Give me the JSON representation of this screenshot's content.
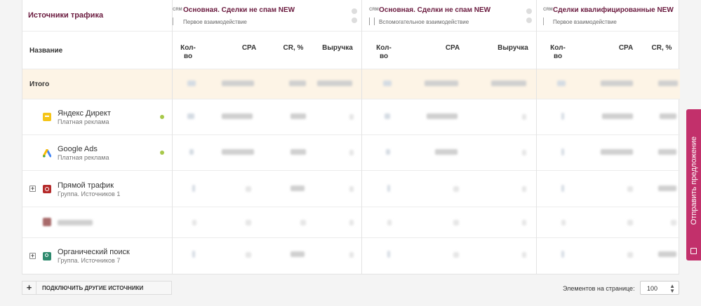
{
  "left_panel": {
    "title": "Источники трафика",
    "name_header": "Название",
    "total_label": "Итого"
  },
  "sources": [
    {
      "name": "Яндекс Директ",
      "sub": "Платная реклама"
    },
    {
      "name": "Google Ads",
      "sub": "Платная реклама"
    },
    {
      "name": "Прямой трафик",
      "sub": "Группа. Источников 1"
    },
    {
      "name": "",
      "sub": ""
    },
    {
      "name": "Органический поиск",
      "sub": "Группа. Источников 7"
    }
  ],
  "column_groups": [
    {
      "crm": "CRM",
      "title": "Основная. Сделки не спам NEW",
      "sub": "Первое взаимодействие",
      "cols": [
        "Кол-\nво",
        "CPA",
        "CR, %",
        "Выручка"
      ]
    },
    {
      "crm": "CRM",
      "title": "Основная. Сделки не спам NEW",
      "sub": "Вспомогательное взаимодействие",
      "cols": [
        "Кол-\nво",
        "CPA",
        "Выручка"
      ]
    },
    {
      "crm": "CRM",
      "title": "Сделки квалифицированные NEW",
      "sub": "Первое взаимодействие",
      "cols": [
        "Кол-\nво",
        "CPA",
        "CR, %"
      ]
    }
  ],
  "footer": {
    "connect_label": "ПОДКЛЮЧИТЬ ДРУГИЕ ИСТОЧНИКИ",
    "per_page_label": "Элементов на странице:",
    "per_page_value": "100"
  },
  "side_tab": {
    "label": "Отправить предложение"
  },
  "colors": {
    "accent": "#6a1a3e",
    "tab": "#c2306b",
    "total_bg": "#fdf4e6"
  }
}
